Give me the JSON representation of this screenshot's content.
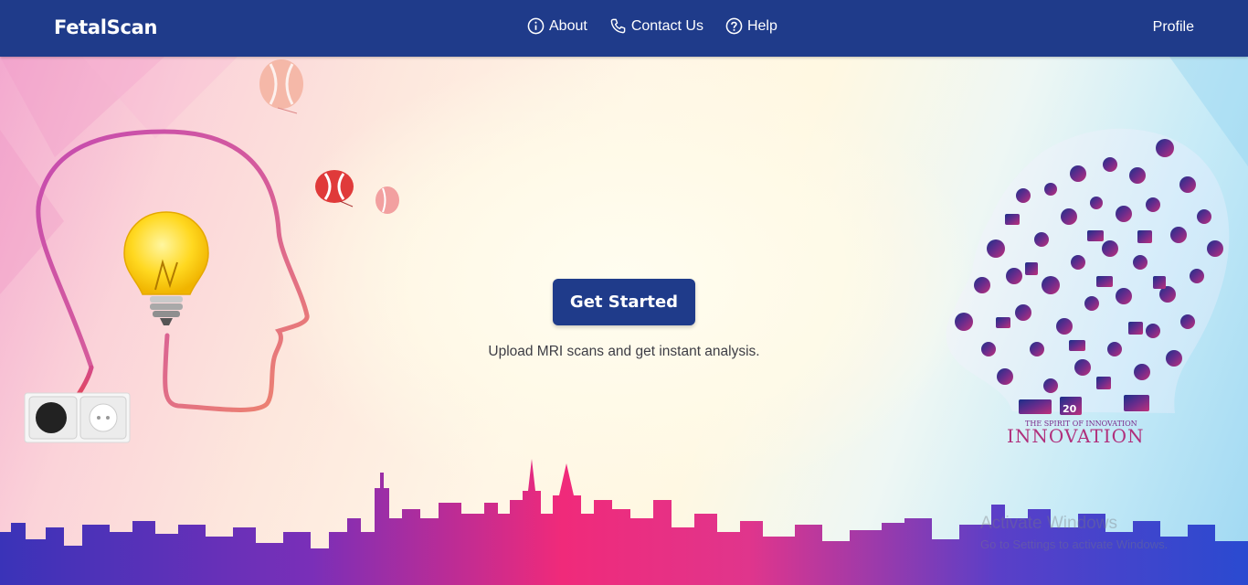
{
  "brand": {
    "name": "FetalScan"
  },
  "nav": {
    "links": [
      {
        "label": "About",
        "icon": "info-icon"
      },
      {
        "label": "Contact Us",
        "icon": "phone-icon"
      },
      {
        "label": "Help",
        "icon": "question-icon"
      }
    ],
    "profile_label": "Profile"
  },
  "hero": {
    "cta_label": "Get Started",
    "tagline": "Upload MRI scans and get instant analysis.",
    "illustration_left": "head-lightbulb-illustration",
    "illustration_right": "innovation-head-icon-collage",
    "innovation_text": "INNOVATION",
    "innovation_sub": "THE SPIRIT OF INNOVATION",
    "innovation_badge": "20"
  },
  "watermark": {
    "title": "Activate Windows",
    "subtitle": "Go to Settings to activate Windows."
  },
  "colors": {
    "navbar": "#1f3b8a",
    "button": "#1f3b8a",
    "text_on_nav": "#ffffff"
  }
}
